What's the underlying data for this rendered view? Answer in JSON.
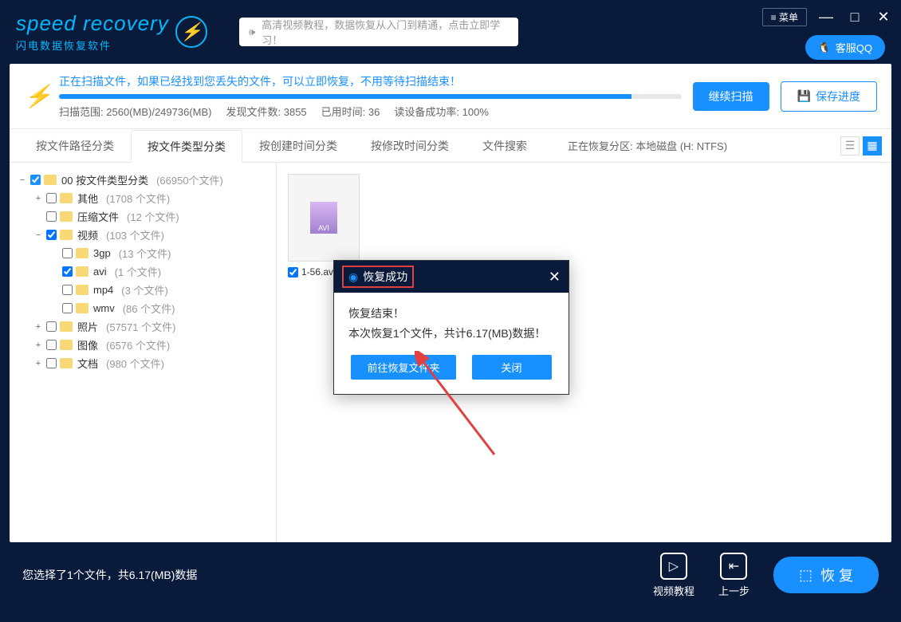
{
  "header": {
    "logo_text": "speed recovery",
    "logo_sub": "闪电数据恢复软件",
    "menu_label": "菜单",
    "promo_text": "高清视频教程，数据恢复从入门到精通，点击立即学习！",
    "qq_label": "客服QQ"
  },
  "scan": {
    "message": "正在扫描文件，如果已经找到您丢失的文件，可以立即恢复，不用等待扫描结束！",
    "range_label": "扫描范围:",
    "range_value": "2560(MB)/249736(MB)",
    "found_label": "发现文件数:",
    "found_value": "3855",
    "time_label": "已用时间:",
    "time_value": "36",
    "rate_label": "读设备成功率:",
    "rate_value": "100%",
    "btn_continue": "继续扫描",
    "btn_save": "保存进度"
  },
  "tabs": {
    "items": [
      "按文件路径分类",
      "按文件类型分类",
      "按创建时间分类",
      "按修改时间分类",
      "文件搜索"
    ],
    "active": 1,
    "partition_label": "正在恢复分区: 本地磁盘 (H: NTFS)"
  },
  "tree": {
    "root": {
      "label": "00 按文件类型分类",
      "count": "(66950个文件)"
    },
    "nodes": [
      {
        "label": "其他",
        "count": "(1708 个文件)",
        "indent": 1,
        "toggle": "+"
      },
      {
        "label": "压缩文件",
        "count": "(12 个文件)",
        "indent": 1,
        "toggle": ""
      },
      {
        "label": "视频",
        "count": "(103 个文件)",
        "indent": 1,
        "toggle": "−",
        "checked": true
      },
      {
        "label": "3gp",
        "count": "(13 个文件)",
        "indent": 2,
        "toggle": ""
      },
      {
        "label": "avi",
        "count": "(1 个文件)",
        "indent": 2,
        "toggle": "",
        "checked": true
      },
      {
        "label": "mp4",
        "count": "(3 个文件)",
        "indent": 2,
        "toggle": ""
      },
      {
        "label": "wmv",
        "count": "(86 个文件)",
        "indent": 2,
        "toggle": ""
      },
      {
        "label": "照片",
        "count": "(57571 个文件)",
        "indent": 1,
        "toggle": "+"
      },
      {
        "label": "图像",
        "count": "(6576 个文件)",
        "indent": 1,
        "toggle": "+"
      },
      {
        "label": "文档",
        "count": "(980 个文件)",
        "indent": 1,
        "toggle": "+"
      }
    ]
  },
  "file": {
    "name": "1-56.avi",
    "thumb_label": "AVI"
  },
  "dialog": {
    "title": "恢复成功",
    "line1": "恢复结束！",
    "line2": "本次恢复1个文件，共计6.17(MB)数据！",
    "btn_goto": "前往恢复文件夹",
    "btn_close": "关闭"
  },
  "footer": {
    "status": "您选择了1个文件，共6.17(MB)数据",
    "tutorial": "视频教程",
    "back": "上一步",
    "recover": "恢 复"
  }
}
